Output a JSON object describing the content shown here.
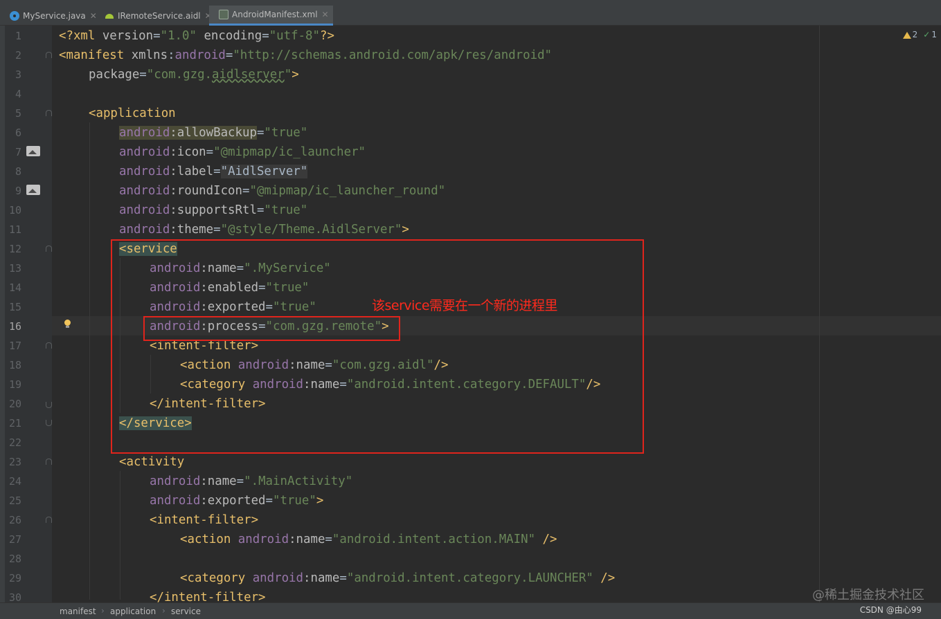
{
  "tabs": [
    {
      "label": "MyService.java",
      "icon": "java-class-icon"
    },
    {
      "label": "IRemoteService.aidl",
      "icon": "android-icon"
    },
    {
      "label": "AndroidManifest.xml",
      "icon": "manifest-file-icon",
      "active": true
    }
  ],
  "inspections": {
    "warnings": "2",
    "ok": "1"
  },
  "line_numbers": [
    "1",
    "2",
    "3",
    "4",
    "5",
    "6",
    "7",
    "8",
    "9",
    "10",
    "11",
    "12",
    "13",
    "14",
    "15",
    "16",
    "17",
    "18",
    "19",
    "20",
    "21",
    "22",
    "23",
    "24",
    "25",
    "26",
    "27",
    "28",
    "29",
    "30"
  ],
  "current_line": "16",
  "code": {
    "l1": {
      "a": "<?xml",
      "b": " version",
      "c": "=",
      "d": "\"1.0\"",
      "e": " encoding",
      "f": "=",
      "g": "\"utf-8\"",
      "h": "?>"
    },
    "l2": {
      "a": "<manifest",
      "b": " xmlns",
      "c": ":",
      "d": "android",
      "e": "=",
      "f": "\"http://schemas.android.com/apk/res/android\""
    },
    "l3": {
      "a": "package",
      "b": "=",
      "c": "\"com.gzg.",
      "d": "aidlserver",
      "e": "\"",
      "f": ">"
    },
    "l5": {
      "a": "<application"
    },
    "l6": {
      "ns": "android",
      "attr": ":allowBackup",
      "eq": "=",
      "val": "\"true\""
    },
    "l7": {
      "ns": "android",
      "attr": ":icon",
      "eq": "=",
      "val": "\"@mipmap/ic_launcher\""
    },
    "l8": {
      "ns": "android",
      "attr": ":label",
      "eq": "=",
      "val": "\"AidlServer\""
    },
    "l9": {
      "ns": "android",
      "attr": ":roundIcon",
      "eq": "=",
      "val": "\"@mipmap/ic_launcher_round\""
    },
    "l10": {
      "ns": "android",
      "attr": ":supportsRtl",
      "eq": "=",
      "val": "\"true\""
    },
    "l11": {
      "ns": "android",
      "attr": ":theme",
      "eq": "=",
      "val": "\"@style/Theme.AidlServer\"",
      "end": ">"
    },
    "l12": {
      "a": "<service"
    },
    "l13": {
      "ns": "android",
      "attr": ":name",
      "eq": "=",
      "val": "\".MyService\""
    },
    "l14": {
      "ns": "android",
      "attr": ":enabled",
      "eq": "=",
      "val": "\"true\""
    },
    "l15": {
      "ns": "android",
      "attr": ":exported",
      "eq": "=",
      "val": "\"true\""
    },
    "l16": {
      "ns": "android",
      "attr": ":process",
      "eq": "=",
      "val": "\"com.gzg.remote\"",
      "end": ">"
    },
    "l17": {
      "a": "<intent-filter>"
    },
    "l18": {
      "a": "<action",
      "ns": " android",
      "attr": ":name",
      "eq": "=",
      "val": "\"com.gzg.aidl\"",
      "end": "/>"
    },
    "l19": {
      "a": "<category",
      "ns": " android",
      "attr": ":name",
      "eq": "=",
      "val": "\"android.intent.category.DEFAULT\"",
      "end": "/>"
    },
    "l20": {
      "a": "</intent-filter>"
    },
    "l21": {
      "a": "</service>"
    },
    "l23": {
      "a": "<activity"
    },
    "l24": {
      "ns": "android",
      "attr": ":name",
      "eq": "=",
      "val": "\".MainActivity\""
    },
    "l25": {
      "ns": "android",
      "attr": ":exported",
      "eq": "=",
      "val": "\"true\"",
      "end": ">"
    },
    "l26": {
      "a": "<intent-filter>"
    },
    "l27": {
      "a": "<action",
      "ns": " android",
      "attr": ":name",
      "eq": "=",
      "val": "\"android.intent.action.MAIN\"",
      "end": " />"
    },
    "l29": {
      "a": "<category",
      "ns": " android",
      "attr": ":name",
      "eq": "=",
      "val": "\"android.intent.category.LAUNCHER\"",
      "end": " />"
    },
    "l30": {
      "a": "</intent-filter>"
    }
  },
  "annotation": {
    "text": "该service需要在一个新的进程里",
    "color": "#ff2a1d"
  },
  "breadcrumb": [
    "manifest",
    "application",
    "service"
  ],
  "watermark": {
    "site": "@稀土掘金技术社区",
    "author": "CSDN @由心99"
  }
}
